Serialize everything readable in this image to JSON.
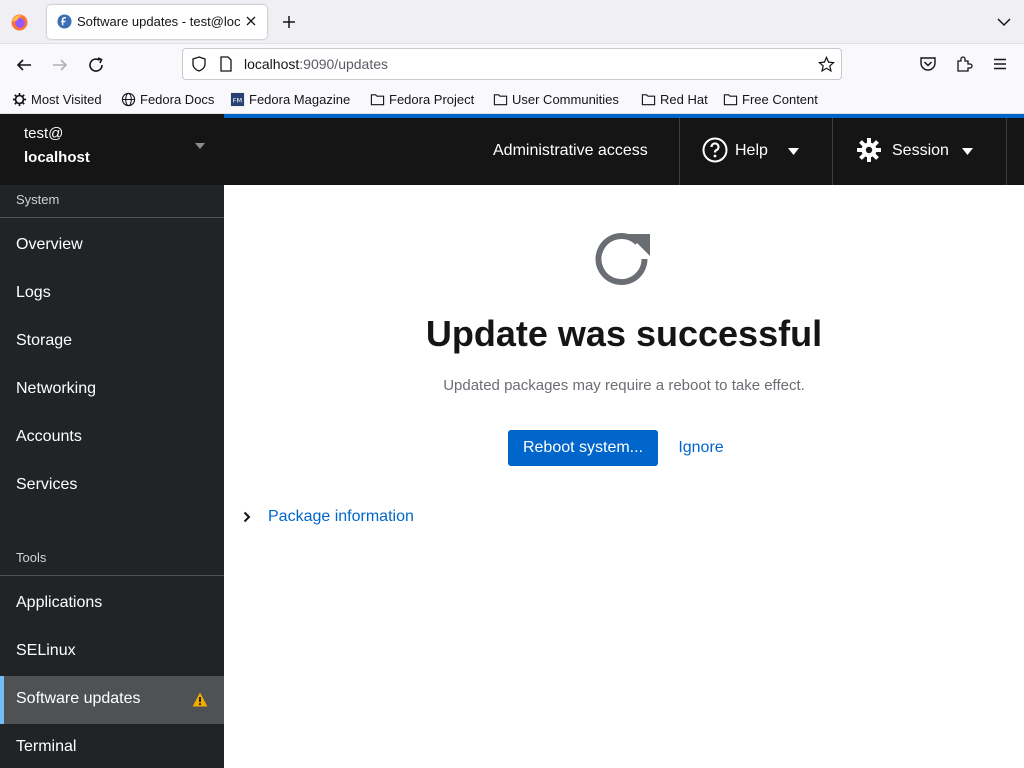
{
  "browser": {
    "tab": {
      "title": "Software updates - test@localhost"
    },
    "url": {
      "host": "localhost",
      "path": ":9090/updates"
    },
    "bookmarks": [
      {
        "label": "Most Visited",
        "icon": "gear-icon"
      },
      {
        "label": "Fedora Docs",
        "icon": "globe-icon"
      },
      {
        "label": "Fedora Magazine",
        "icon": "fedora-magazine-icon"
      },
      {
        "label": "Fedora Project",
        "icon": "folder-icon"
      },
      {
        "label": "User Communities",
        "icon": "folder-icon"
      },
      {
        "label": "Red Hat",
        "icon": "folder-icon"
      },
      {
        "label": "Free Content",
        "icon": "folder-icon"
      }
    ]
  },
  "host": {
    "user": "test@",
    "name": "localhost"
  },
  "sidebar": {
    "sections": [
      {
        "label": "System",
        "items": [
          "Overview",
          "Logs",
          "Storage",
          "Networking",
          "Accounts",
          "Services"
        ]
      },
      {
        "label": "Tools",
        "items": [
          "Applications",
          "SELinux",
          "Software updates",
          "Terminal"
        ]
      }
    ],
    "active_item": "Software updates",
    "active_item_badge": "warning-icon"
  },
  "masthead": {
    "admin_access": "Administrative access",
    "help_label": "Help",
    "session_label": "Session"
  },
  "main": {
    "icon": "refresh-icon",
    "title": "Update was successful",
    "body": "Updated packages may require a reboot to take effect.",
    "primary_action": "Reboot system...",
    "secondary_action": "Ignore",
    "expandable_label": "Package information"
  },
  "colors": {
    "accent": "#0066cc",
    "sidebar_bg": "#212427",
    "masthead_bg": "#151515",
    "active_indicator": "#73bcf7",
    "warning": "#f0ab00"
  }
}
